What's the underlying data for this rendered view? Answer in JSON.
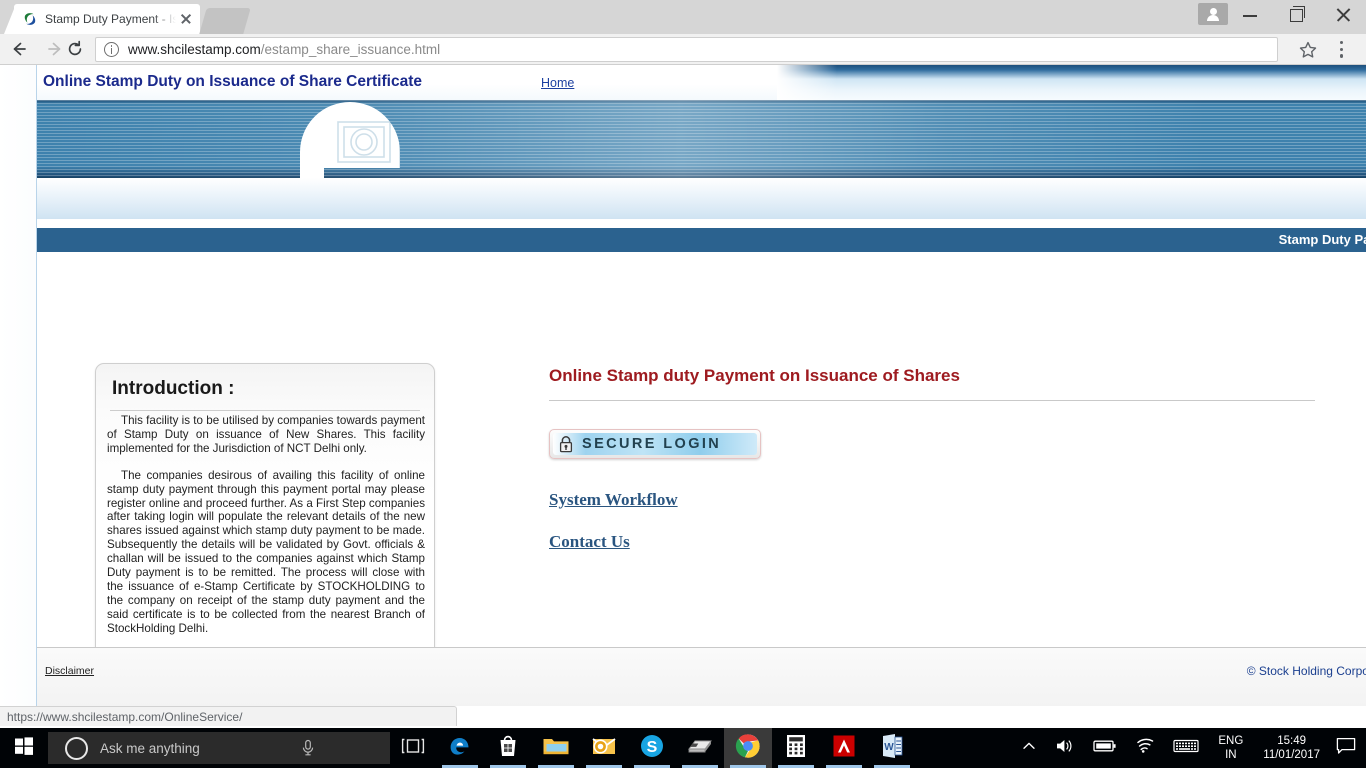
{
  "browser": {
    "tab": {
      "title": "Stamp Duty Payment - Is",
      "favicon_name": "shcil-logo-favicon",
      "close_label": "×"
    },
    "omnibox": {
      "url_host": "www.shcilestamp.com",
      "url_path": "/estamp_share_issuance.html",
      "security_icon": "info-circle-icon"
    },
    "status_bubble": "https://www.shcilestamp.com/OnlineService/"
  },
  "site": {
    "header": {
      "title": "Online Stamp Duty on Issuance of Share Certificate",
      "home_link": "Home"
    },
    "caption_bar": "Stamp Duty Payment on Issua",
    "intro": {
      "heading": "Introduction :",
      "paragraph1": "This facility is to be utilised by companies towards payment of Stamp Duty on issuance of New Shares. This facility implemented for the Jurisdiction of NCT Delhi only.",
      "paragraph2": "The companies desirous of availing this facility of online stamp duty payment through this payment portal may please register online and proceed further. As a First Step companies after taking login will populate the relevant details of the new shares issued against which stamp duty payment to be made. Subsequently the details will be validated by Govt. officials & challan will be issued to the companies against which Stamp Duty payment is to be remitted. The process will close with the issuance of e-Stamp Certificate by STOCKHOLDING to the company on receipt of the stamp duty payment and the said certificate is to be collected from the nearest Branch of StockHolding Delhi."
    },
    "main": {
      "heading": "Online Stamp duty Payment on Issuance of Shares",
      "login_button": "SECURE  LOGIN",
      "link_workflow": "System Workflow",
      "link_contact": "Contact Us"
    },
    "footer": {
      "disclaimer": "Disclaimer",
      "copyright": "© Stock Holding Corporation of India Ltd."
    }
  },
  "taskbar": {
    "search_placeholder": "Ask me anything",
    "apps": [
      "edge-icon",
      "microsoft-store-icon",
      "file-explorer-icon",
      "outlook-icon",
      "skype-icon",
      "scanner-icon",
      "chrome-icon",
      "calculator-icon",
      "adobe-reader-icon",
      "word-icon"
    ],
    "language_line1": "ENG",
    "language_line2": "IN",
    "time": "15:49",
    "date": "11/01/2017"
  },
  "colors": {
    "accent_blue": "#2b628f",
    "heading_red": "#9e1b20",
    "link_blue": "#2a5580",
    "title_navy": "#1b2a8c"
  }
}
